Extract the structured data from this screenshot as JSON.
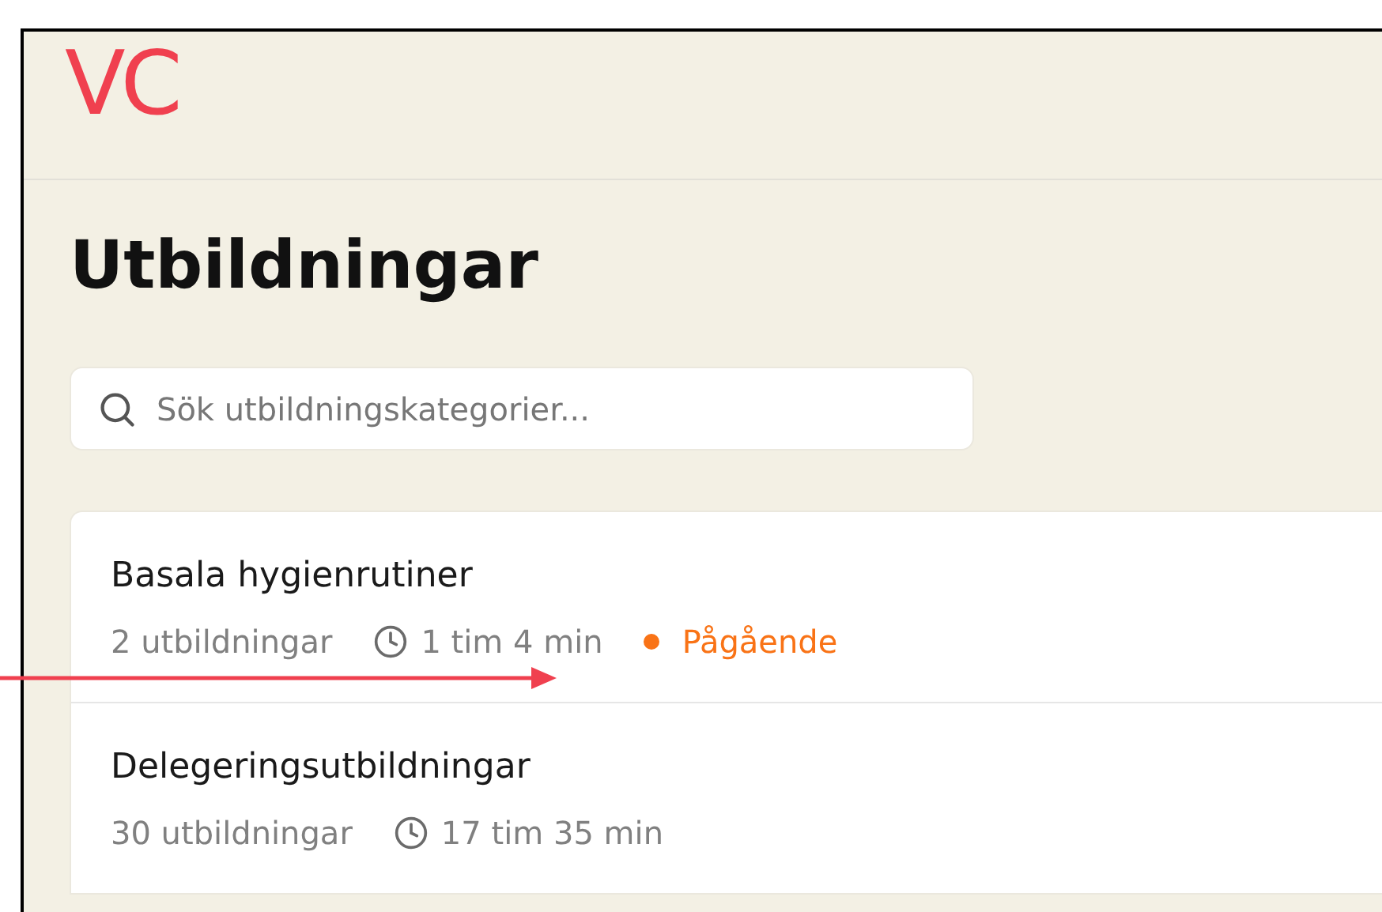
{
  "logo": "VC",
  "page": {
    "title": "Utbildningar"
  },
  "search": {
    "placeholder": "Sök utbildningskategorier..."
  },
  "categories": [
    {
      "title": "Basala hygienrutiner",
      "count": "2 utbildningar",
      "duration": "1 tim 4 min",
      "status": {
        "label": "Pågående",
        "color": "#f97316"
      }
    },
    {
      "title": "Delegeringsutbildningar",
      "count": "30 utbildningar",
      "duration": "17 tim 35 min"
    }
  ],
  "annotation": {
    "kind": "arrow"
  }
}
